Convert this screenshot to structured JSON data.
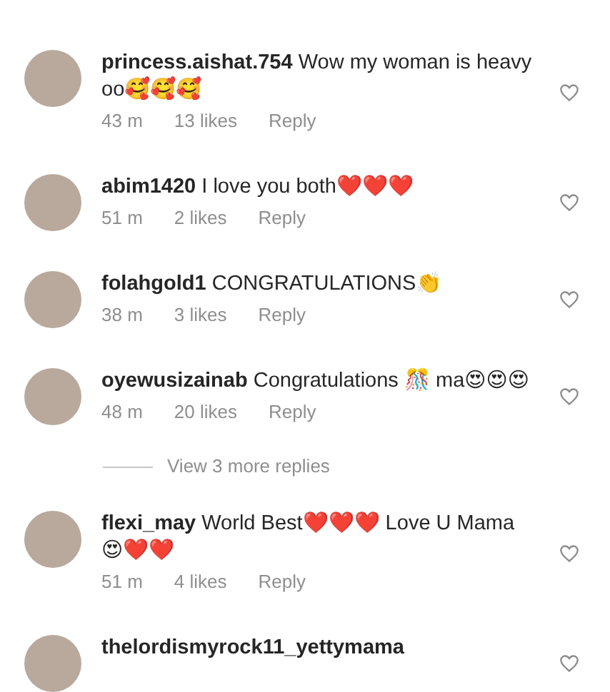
{
  "items": [
    {
      "kind": "comment",
      "username": "princess.aishat.754",
      "text": "Wow my woman is heavy oo🥰🥰🥰",
      "time": "43 m",
      "likes": "13 likes",
      "reply": "Reply"
    },
    {
      "kind": "comment",
      "username": "abim1420",
      "text": "I love you both❤️❤️❤️",
      "time": "51 m",
      "likes": "2 likes",
      "reply": "Reply"
    },
    {
      "kind": "comment",
      "username": "folahgold1",
      "text": "CONGRATULATIONS👏",
      "time": "38 m",
      "likes": "3 likes",
      "reply": "Reply"
    },
    {
      "kind": "comment",
      "username": "oyewusizainab",
      "text": "Congratulations 🎊 ma😍😍😍",
      "time": "48 m",
      "likes": "20 likes",
      "reply": "Reply"
    },
    {
      "kind": "more_replies",
      "label": "View 3 more replies"
    },
    {
      "kind": "comment",
      "username": "flexi_may",
      "text": "World Best❤️❤️❤️ Love U Mama 😍❤️❤️",
      "time": "51 m",
      "likes": "4 likes",
      "reply": "Reply"
    },
    {
      "kind": "comment",
      "username": "thelordismyrock11_yettymama"
    }
  ]
}
